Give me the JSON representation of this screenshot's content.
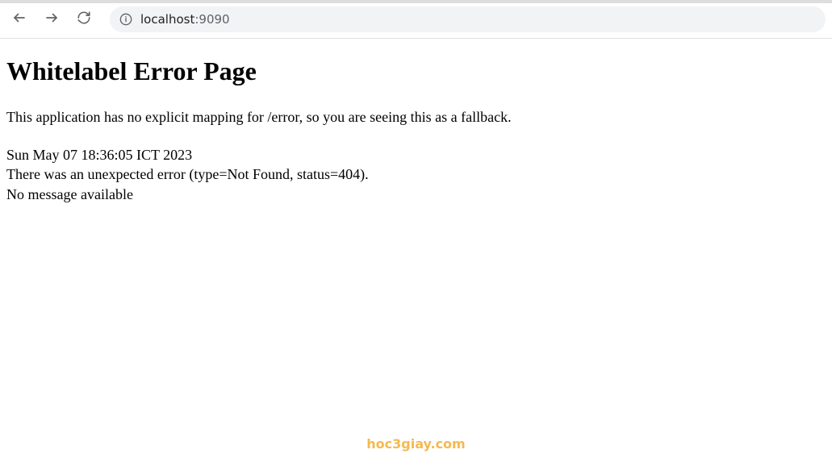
{
  "browser": {
    "url_host": "localhost",
    "url_port": ":9090"
  },
  "error": {
    "title": "Whitelabel Error Page",
    "description": "This application has no explicit mapping for /error, so you are seeing this as a fallback.",
    "timestamp": "Sun May 07 18:36:05 ICT 2023",
    "detail": "There was an unexpected error (type=Not Found, status=404).",
    "message": "No message available"
  },
  "watermark": "hoc3giay.com"
}
